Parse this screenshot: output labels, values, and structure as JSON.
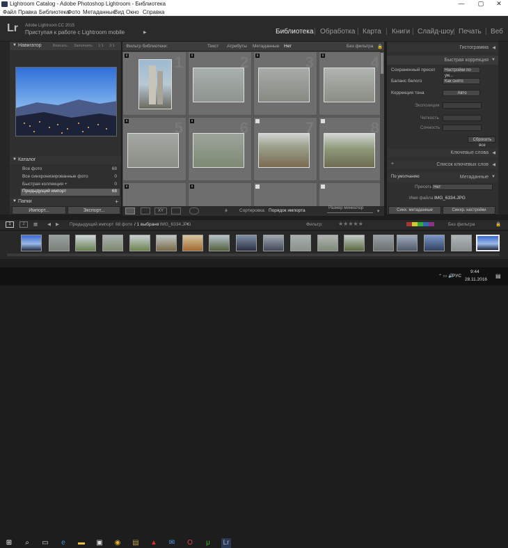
{
  "window": {
    "title": "Lightroom Catalog - Adobe Photoshop Lightroom - Библиотека",
    "minimize": "—",
    "maximize": "▢",
    "close": "✕"
  },
  "menu": [
    "Файл",
    "Правка",
    "Библиотека",
    "Фото",
    "Метаданные",
    "Вид",
    "Окно",
    "Справка"
  ],
  "identity": {
    "logo": "Lr",
    "product": "Adobe Lightroom CC 2015",
    "message": "Приступая к работе с Lightroom mobile",
    "play": "▶"
  },
  "modules": [
    "Библиотека",
    "Обработка",
    "Карта",
    "Книги",
    "Слайд-шоу",
    "Печать",
    "Веб"
  ],
  "navigator": {
    "title": "Навигатор",
    "opts": [
      "Вписать",
      "Заполнить",
      "1:1",
      "3:1"
    ]
  },
  "catalog": {
    "title": "Каталог",
    "items": [
      {
        "name": "Все фото",
        "count": "68"
      },
      {
        "name": "Все синхронизированные фото",
        "count": "0"
      },
      {
        "name": "Быстрая коллекция +",
        "count": "0"
      },
      {
        "name": "Предыдущий импорт",
        "count": "68"
      }
    ]
  },
  "folders": {
    "title": "Папки"
  },
  "left_buttons": {
    "import": "Импорт...",
    "export": "Экспорт..."
  },
  "filterbar": {
    "title": "Фильтр библиотеки:",
    "opts": [
      "Текст",
      "Атрибуты",
      "Метаданные",
      "Нет"
    ],
    "nofilter": "Без фильтра"
  },
  "grid_numbers": [
    "1",
    "2",
    "3",
    "4",
    "5",
    "6",
    "7",
    "8"
  ],
  "toolbar": {
    "sort_label": "Сортировка:",
    "sort_value": "Порядок импорта",
    "thumb_label": "Размер миниатюр"
  },
  "right": {
    "histogram": "Гистограмма",
    "quick_dev": "Быстрая коррекция",
    "saved_preset": "Сохраненный пресет",
    "preset_value": "Настройки по ум...",
    "wb": "Баланс белого",
    "wb_value": "Как снято",
    "tone": "Коррекция тона",
    "auto": "Авто",
    "exposure": "Экспозиция",
    "clarity": "Четкость",
    "vibrance": "Сочность",
    "reset": "Сбросить все",
    "keywording": "Ключевые слова",
    "keyword_list": "Список ключевых слов",
    "metadata": "Метаданные",
    "default": "По умолчанию",
    "presets_label": "Пресеты",
    "presets_value": "Нет",
    "filename_label": "Имя файла",
    "filename_value": "IMG_6334.JPG",
    "sync_meta": "Синх. метаданные",
    "sync_settings": "Синхр. настройки"
  },
  "filmstrip": {
    "source": "Предыдущий импорт",
    "count": "68 фото",
    "selected": "/ 1 выбрано",
    "file": "/ IMG_6334.JPG",
    "filter_label": "Фильтр:",
    "filter_value": "Без фильтра",
    "pages": [
      "1",
      "2"
    ]
  },
  "taskbar": {
    "lang": "РУС",
    "time": "9:44",
    "date": "28.11.2016"
  }
}
